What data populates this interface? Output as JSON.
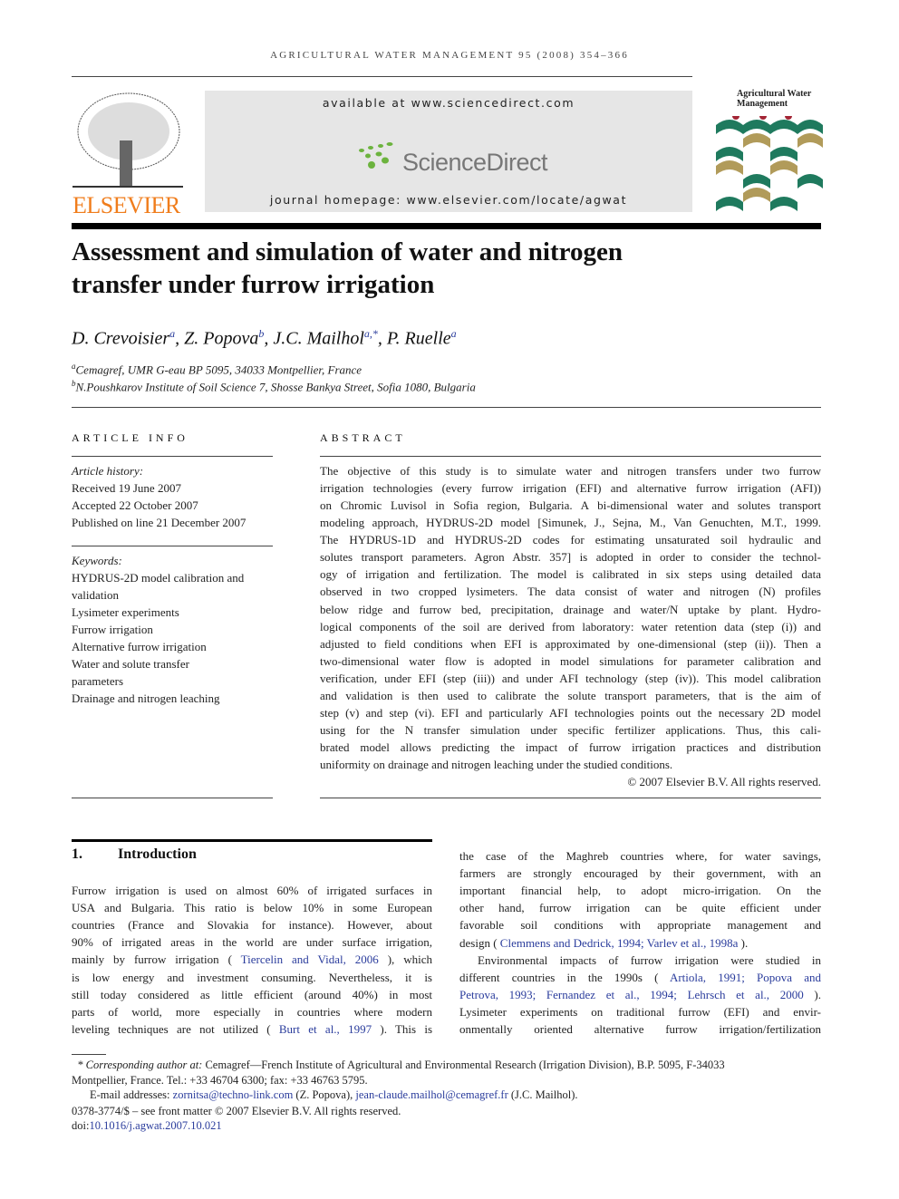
{
  "header": {
    "running_head": "AGRICULTURAL WATER MANAGEMENT 95 (2008) 354–366",
    "available": "available at www.sciencedirect.com",
    "sd_logo": "ScienceDirect",
    "homepage": "journal homepage: www.elsevier.com/locate/agwat",
    "publisher": "ELSEVIER",
    "journal_cover_title": "Agricultural Water Management"
  },
  "colors": {
    "elsevier": "#f07d1c",
    "link": "#2a3c9c",
    "sd_green": "#6cb33e"
  },
  "article": {
    "title_lines": [
      "Assessment and simulation of water and nitrogen",
      "transfer under furrow irrigation"
    ],
    "authors": [
      {
        "name": "D. Crevoisier",
        "sup": "a"
      },
      {
        "name": "Z. Popova",
        "sup": "b"
      },
      {
        "name": "J.C. Mailhol",
        "sup": "a,*"
      },
      {
        "name": "P. Ruelle",
        "sup": "a"
      }
    ],
    "affiliations": [
      {
        "sup": "a",
        "text": "Cemagref, UMR G-eau BP 5095, 34033 Montpellier, France"
      },
      {
        "sup": "b",
        "text": "N.Poushkarov Institute of Soil Science 7, Shosse Bankya Street, Sofia 1080, Bulgaria"
      }
    ]
  },
  "info": {
    "heading": "ARTICLE INFO",
    "history_label": "Article history:",
    "history": [
      "Received 19 June 2007",
      "Accepted 22 October 2007",
      "Published on line 21 December 2007"
    ],
    "keywords_label": "Keywords:",
    "keywords_lines": [
      "HYDRUS-2D model calibration and",
      "validation",
      "Lysimeter experiments",
      "Furrow irrigation",
      "Alternative furrow irrigation",
      "Water and solute transfer",
      "parameters",
      "Drainage and nitrogen leaching"
    ]
  },
  "abstract": {
    "heading": "ABSTRACT",
    "lines": [
      "The objective of this study is to simulate water and nitrogen transfers under two furrow",
      "irrigation technologies (every furrow irrigation (EFI) and alternative furrow irrigation (AFI))",
      "on Chromic Luvisol in Sofia region, Bulgaria. A bi-dimensional water and solutes transport",
      "modeling approach, HYDRUS-2D model [Simunek, J., Sejna, M., Van Genuchten, M.T., 1999.",
      "The HYDRUS-1D and HYDRUS-2D codes for estimating unsaturated soil hydraulic and",
      "solutes transport parameters. Agron Abstr. 357] is adopted in order to consider the technol-",
      "ogy of irrigation and fertilization. The model is calibrated in six steps using detailed data",
      "observed in two cropped lysimeters. The data consist of water and nitrogen (N) profiles",
      "below ridge and furrow bed, precipitation, drainage and water/N uptake by plant. Hydro-",
      "logical components of the soil are derived from laboratory: water retention data (step (i)) and",
      "adjusted to field conditions when EFI is approximated by one-dimensional (step (ii)). Then a",
      "two-dimensional water flow is adopted in model simulations for parameter calibration and",
      "verification, under EFI (step (iii)) and under AFI technology (step (iv)). This model calibration",
      "and validation is then used to calibrate the solute transport parameters, that is the aim of",
      "step (v) and step (vi). EFI and particularly AFI technologies points out the necessary 2D model",
      "using for the N transfer simulation under specific fertilizer applications. Thus, this cali-",
      "brated model allows predicting the impact of furrow irrigation practices and distribution",
      "uniformity on drainage and nitrogen leaching under the studied conditions."
    ],
    "copyright": "© 2007 Elsevier B.V. All rights reserved."
  },
  "intro": {
    "number": "1.",
    "heading": "Introduction",
    "left_lines": [
      [
        {
          "t": "Furrow irrigation is used on almost 60% of irrigated surfaces in"
        }
      ],
      [
        {
          "t": "USA and Bulgaria. This ratio is below 10% in some European"
        }
      ],
      [
        {
          "t": "countries (France and Slovakia for instance). However, about"
        }
      ],
      [
        {
          "t": "90% of irrigated areas in the world are under surface irrigation,"
        }
      ],
      [
        {
          "t": "mainly by furrow irrigation ("
        },
        {
          "t": "Tiercelin and Vidal, 2006",
          "l": 1
        },
        {
          "t": "), which"
        }
      ],
      [
        {
          "t": "is low energy and investment consuming. Nevertheless, it is"
        }
      ],
      [
        {
          "t": "still today considered as little efficient (around 40%) in most"
        }
      ],
      [
        {
          "t": "parts of world, more especially in countries where modern"
        }
      ],
      [
        {
          "t": "leveling techniques are not utilized ("
        },
        {
          "t": "Burt et al., 1997",
          "l": 1
        },
        {
          "t": "). This is"
        }
      ]
    ],
    "right_lines": [
      [
        {
          "t": "the case of the Maghreb countries where, for water savings,"
        }
      ],
      [
        {
          "t": "farmers are strongly encouraged by their government, with an"
        }
      ],
      [
        {
          "t": "important financial help, to adopt micro-irrigation. On the"
        }
      ],
      [
        {
          "t": "other hand, furrow irrigation can be quite efficient under"
        }
      ],
      [
        {
          "t": "favorable soil conditions with appropriate management and"
        }
      ],
      [
        {
          "t": "design ("
        },
        {
          "t": "Clemmens and Dedrick, 1994; Varlev et al., 1998a",
          "l": 1
        },
        {
          "t": ")."
        }
      ],
      [
        {
          "t": "Environmental impacts of furrow irrigation were studied in"
        }
      ],
      [
        {
          "t": "different countries in the 1990s ("
        },
        {
          "t": "Artiola, 1991; Popova and",
          "l": 1
        }
      ],
      [
        {
          "t": "Petrova, 1993; Fernandez et al., 1994; Lehrsch et al., 2000",
          "l": 1
        },
        {
          "t": ")."
        }
      ],
      [
        {
          "t": "Lysimeter experiments on traditional furrow (EFI) and envir-"
        }
      ],
      [
        {
          "t": "onmentally oriented alternative furrow irrigation/fertilization"
        }
      ]
    ]
  },
  "footnotes": {
    "corr_label": "* Corresponding author at:",
    "corr_text": " Cemagref—French Institute of Agricultural and Environmental Research (Irrigation Division), B.P. 5095, F-34033",
    "corr_text2": "Montpellier, France. Tel.: +33 46704 6300; fax: +33 46763 5795.",
    "email_label": "E-mail addresses: ",
    "email1": "zornitsa@techno-link.com",
    "email1_who": " (Z. Popova), ",
    "email2": "jean-claude.mailhol@cemagref.fr",
    "email2_who": " (J.C. Mailhol).",
    "front_matter": "0378-3774/$ – see front matter © 2007 Elsevier B.V. All rights reserved.",
    "doi_label": "doi:",
    "doi": "10.1016/j.agwat.2007.10.021"
  }
}
